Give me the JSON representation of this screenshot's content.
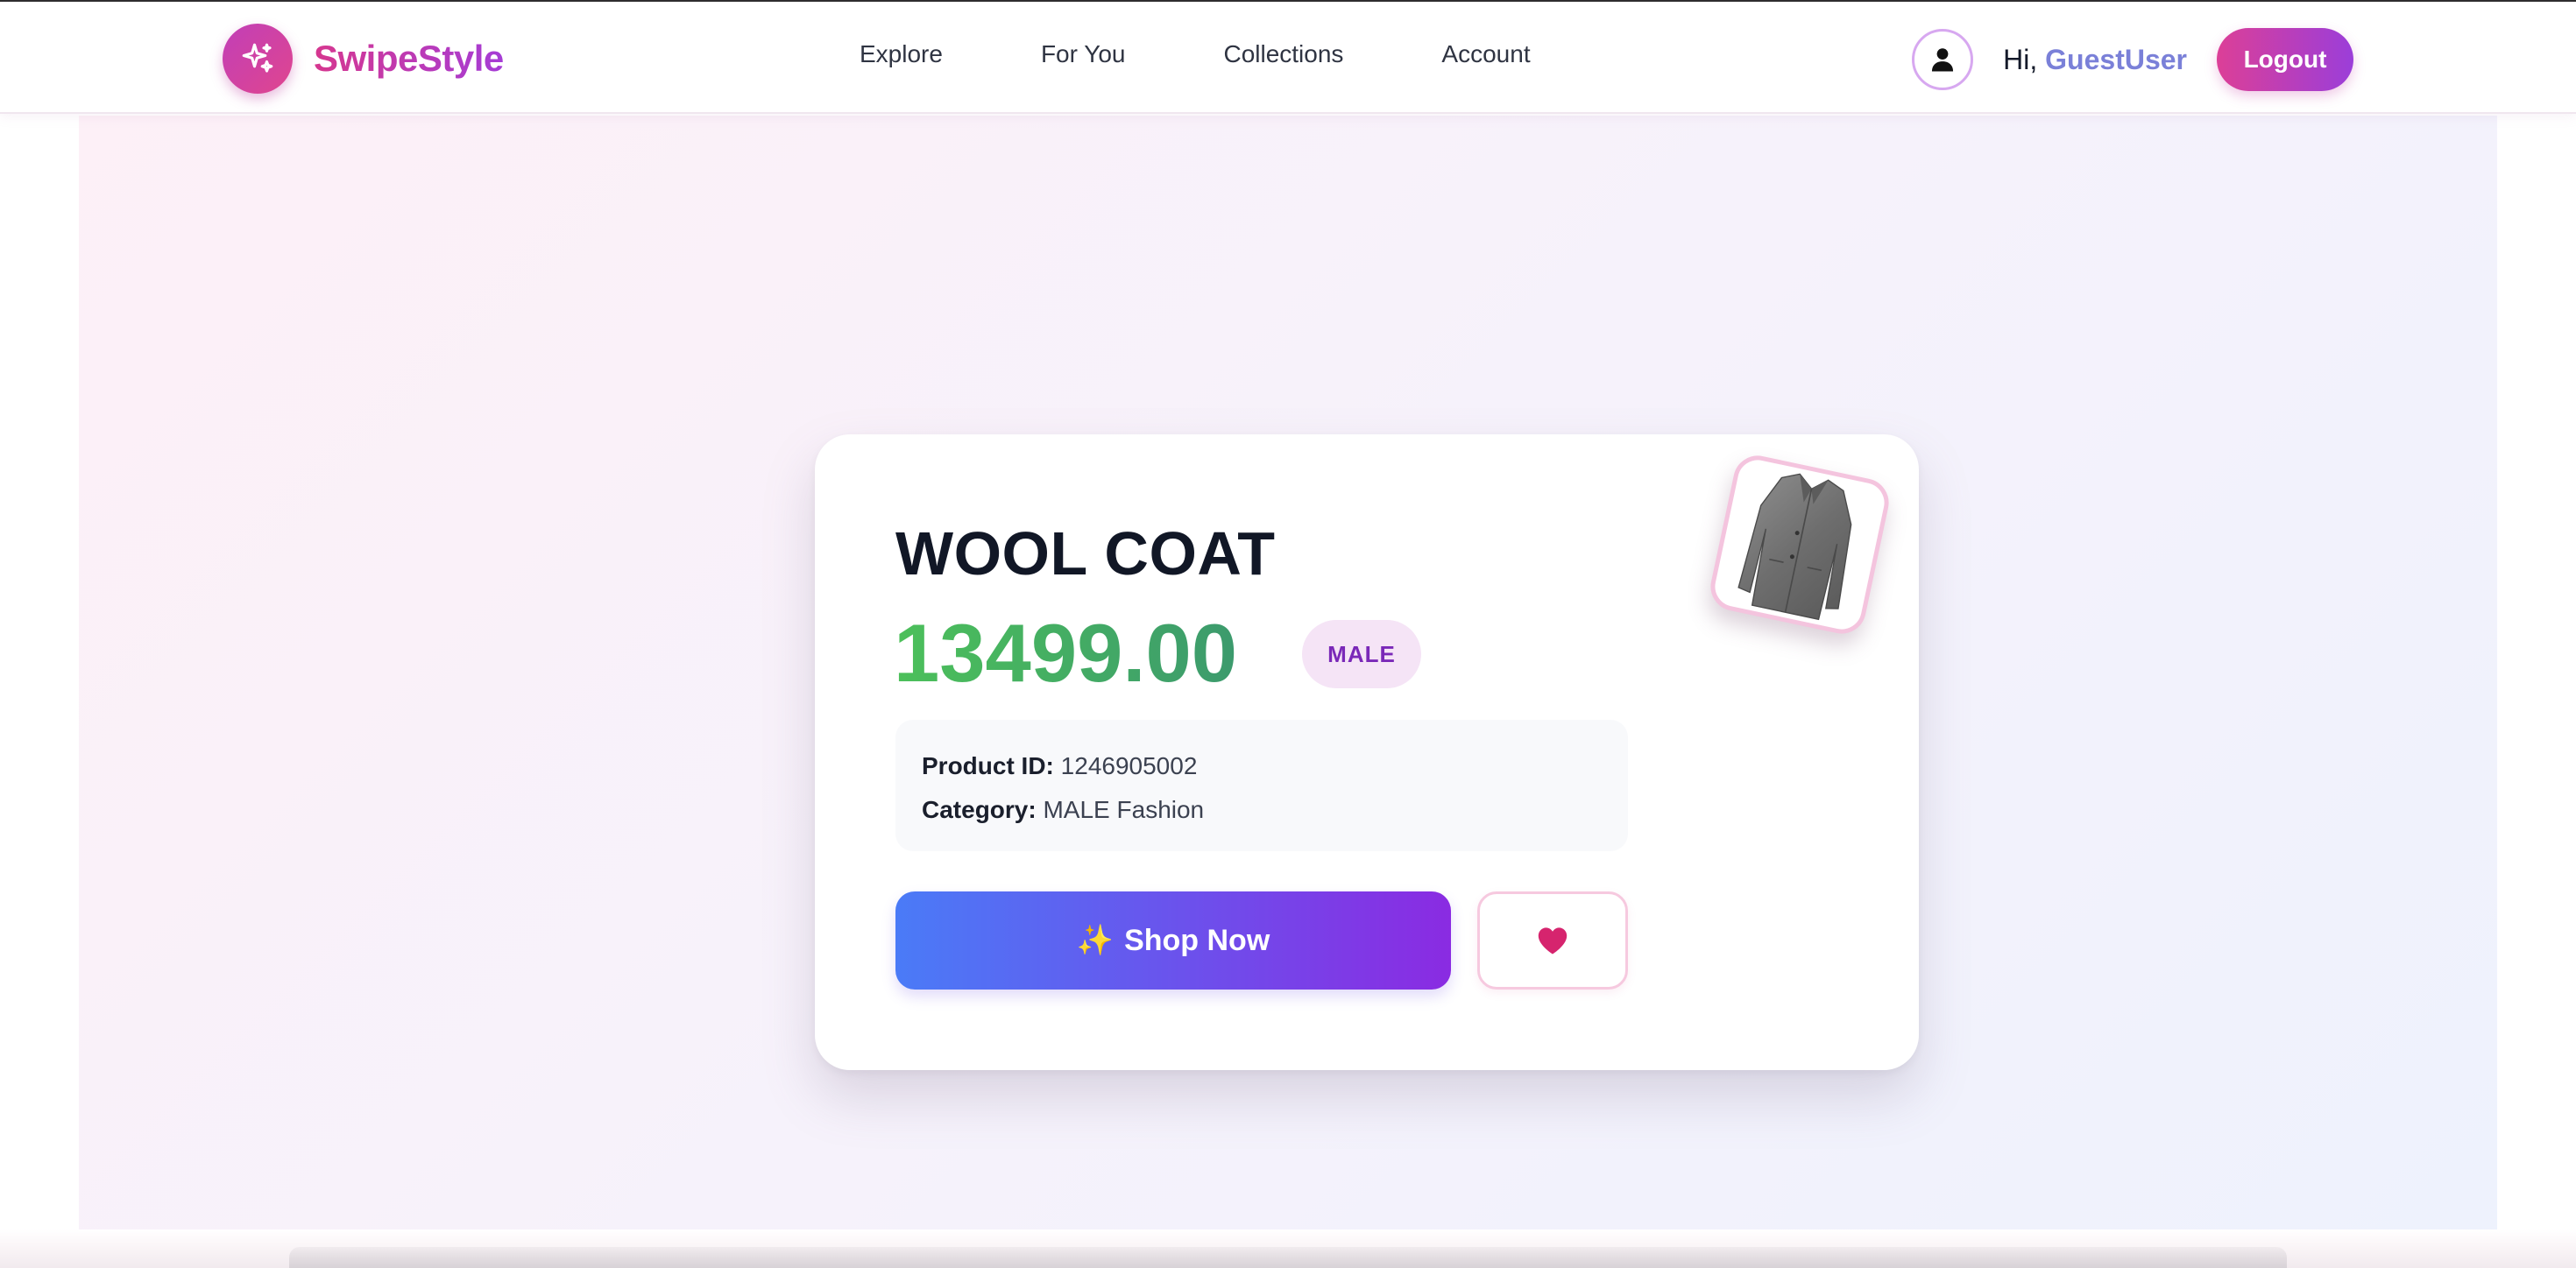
{
  "header": {
    "brand_name": "SwipeStyle",
    "logo_icon": "sparkles-icon",
    "nav": [
      {
        "label": "Explore"
      },
      {
        "label": "For You"
      },
      {
        "label": "Collections"
      },
      {
        "label": "Account"
      }
    ],
    "greeting_prefix": "Hi,",
    "username": "GuestUser",
    "logout_label": "Logout"
  },
  "product": {
    "title": "WOOL COAT",
    "price": "13499.00",
    "gender_badge": "MALE",
    "id_label": "Product ID:",
    "id_value": "1246905002",
    "category_label": "Category:",
    "category_value": "MALE Fashion",
    "shop_icon": "✨",
    "shop_label": "Shop Now",
    "favorite_icon": "heart-icon",
    "image_subject": "grey wool coat"
  },
  "colors": {
    "brand_gradient": [
      "#d6378f",
      "#a53cd6"
    ],
    "price_gradient": [
      "#4cc05a",
      "#3c9a6d"
    ],
    "shop_gradient": [
      "#4a7bf7",
      "#8a2be2"
    ],
    "heart": "#d6246e",
    "badge_bg": "#f5e4f6",
    "badge_text": "#7a28b8"
  }
}
